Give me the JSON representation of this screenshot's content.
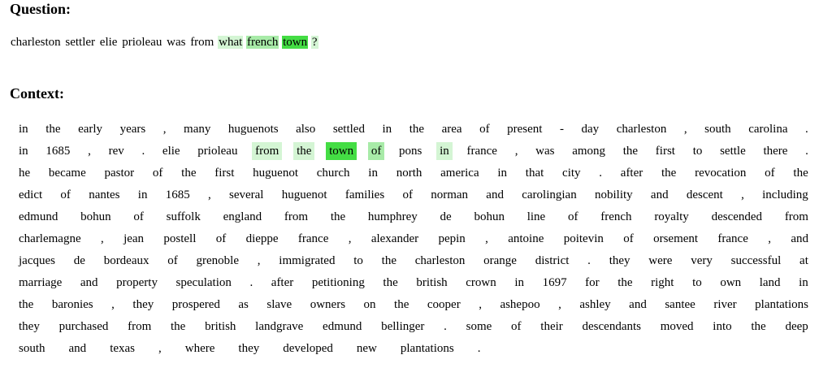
{
  "question_heading": "Question:",
  "context_heading": "Context:",
  "colors": {
    "h1": "#d4f5d4",
    "h2": "#a8eba8",
    "h3": "#44dd44"
  },
  "question_tokens": [
    {
      "t": "charleston",
      "h": 0
    },
    {
      "t": "settler",
      "h": 0
    },
    {
      "t": "elie",
      "h": 0
    },
    {
      "t": "prioleau",
      "h": 0
    },
    {
      "t": "was",
      "h": 0
    },
    {
      "t": "from",
      "h": 0
    },
    {
      "t": "what",
      "h": 1
    },
    {
      "t": "french",
      "h": 2
    },
    {
      "t": "town",
      "h": 3
    },
    {
      "t": "?",
      "h": 1
    }
  ],
  "context_rows": [
    [
      {
        "t": "in"
      },
      {
        "t": "the"
      },
      {
        "t": "early"
      },
      {
        "t": "years"
      },
      {
        "t": ","
      },
      {
        "t": "many"
      },
      {
        "t": "huguenots"
      },
      {
        "t": "also"
      },
      {
        "t": "settled"
      },
      {
        "t": "in"
      },
      {
        "t": "the"
      },
      {
        "t": "area"
      },
      {
        "t": "of"
      },
      {
        "t": "present"
      },
      {
        "t": "-"
      },
      {
        "t": "day"
      },
      {
        "t": "charleston"
      },
      {
        "t": ","
      },
      {
        "t": "south"
      },
      {
        "t": "carolina"
      },
      {
        "t": "."
      }
    ],
    [
      {
        "t": "in"
      },
      {
        "t": "1685"
      },
      {
        "t": ","
      },
      {
        "t": "rev"
      },
      {
        "t": "."
      },
      {
        "t": "elie"
      },
      {
        "t": "prioleau"
      },
      {
        "t": "from",
        "h": 1
      },
      {
        "t": "the",
        "h": 1
      },
      {
        "t": "town",
        "h": 3
      },
      {
        "t": "of",
        "h": 2
      },
      {
        "t": "pons"
      },
      {
        "t": "in",
        "h": 1
      },
      {
        "t": "france"
      },
      {
        "t": ","
      },
      {
        "t": "was"
      },
      {
        "t": "among"
      },
      {
        "t": "the"
      },
      {
        "t": "first"
      },
      {
        "t": "to"
      },
      {
        "t": "settle"
      },
      {
        "t": "there"
      },
      {
        "t": "."
      }
    ],
    [
      {
        "t": "he"
      },
      {
        "t": "became"
      },
      {
        "t": "pastor"
      },
      {
        "t": "of"
      },
      {
        "t": "the"
      },
      {
        "t": "first"
      },
      {
        "t": "huguenot"
      },
      {
        "t": "church"
      },
      {
        "t": "in"
      },
      {
        "t": "north"
      },
      {
        "t": "america"
      },
      {
        "t": "in"
      },
      {
        "t": "that"
      },
      {
        "t": "city"
      },
      {
        "t": "."
      },
      {
        "t": "after"
      },
      {
        "t": "the"
      },
      {
        "t": "revocation"
      },
      {
        "t": "of"
      },
      {
        "t": "the"
      }
    ],
    [
      {
        "t": "edict"
      },
      {
        "t": "of"
      },
      {
        "t": "nantes"
      },
      {
        "t": "in"
      },
      {
        "t": "1685"
      },
      {
        "t": ","
      },
      {
        "t": "several"
      },
      {
        "t": "huguenot"
      },
      {
        "t": "families"
      },
      {
        "t": "of"
      },
      {
        "t": "norman"
      },
      {
        "t": "and"
      },
      {
        "t": "carolingian"
      },
      {
        "t": "nobility"
      },
      {
        "t": "and"
      },
      {
        "t": "descent"
      },
      {
        "t": ","
      },
      {
        "t": "including"
      }
    ],
    [
      {
        "t": "edmund"
      },
      {
        "t": "bohun"
      },
      {
        "t": "of"
      },
      {
        "t": "suffolk"
      },
      {
        "t": "england"
      },
      {
        "t": "from"
      },
      {
        "t": "the"
      },
      {
        "t": "humphrey"
      },
      {
        "t": "de"
      },
      {
        "t": "bohun"
      },
      {
        "t": "line"
      },
      {
        "t": "of"
      },
      {
        "t": "french"
      },
      {
        "t": "royalty"
      },
      {
        "t": "descended"
      },
      {
        "t": "from"
      }
    ],
    [
      {
        "t": "charlemagne"
      },
      {
        "t": ","
      },
      {
        "t": "jean"
      },
      {
        "t": "postell"
      },
      {
        "t": "of"
      },
      {
        "t": "dieppe"
      },
      {
        "t": "france"
      },
      {
        "t": ","
      },
      {
        "t": "alexander"
      },
      {
        "t": "pepin"
      },
      {
        "t": ","
      },
      {
        "t": "antoine"
      },
      {
        "t": "poitevin"
      },
      {
        "t": "of"
      },
      {
        "t": "orsement"
      },
      {
        "t": "france"
      },
      {
        "t": ","
      },
      {
        "t": "and"
      }
    ],
    [
      {
        "t": "jacques"
      },
      {
        "t": "de"
      },
      {
        "t": "bordeaux"
      },
      {
        "t": "of"
      },
      {
        "t": "grenoble"
      },
      {
        "t": ","
      },
      {
        "t": "immigrated"
      },
      {
        "t": "to"
      },
      {
        "t": "the"
      },
      {
        "t": "charleston"
      },
      {
        "t": "orange"
      },
      {
        "t": "district"
      },
      {
        "t": "."
      },
      {
        "t": "they"
      },
      {
        "t": "were"
      },
      {
        "t": "very"
      },
      {
        "t": "successful"
      },
      {
        "t": "at"
      }
    ],
    [
      {
        "t": "marriage"
      },
      {
        "t": "and"
      },
      {
        "t": "property"
      },
      {
        "t": "speculation"
      },
      {
        "t": "."
      },
      {
        "t": "after"
      },
      {
        "t": "petitioning"
      },
      {
        "t": "the"
      },
      {
        "t": "british"
      },
      {
        "t": "crown"
      },
      {
        "t": "in"
      },
      {
        "t": "1697"
      },
      {
        "t": "for"
      },
      {
        "t": "the"
      },
      {
        "t": "right"
      },
      {
        "t": "to"
      },
      {
        "t": "own"
      },
      {
        "t": "land"
      },
      {
        "t": "in"
      }
    ],
    [
      {
        "t": "the"
      },
      {
        "t": "baronies"
      },
      {
        "t": ","
      },
      {
        "t": "they"
      },
      {
        "t": "prospered"
      },
      {
        "t": "as"
      },
      {
        "t": "slave"
      },
      {
        "t": "owners"
      },
      {
        "t": "on"
      },
      {
        "t": "the"
      },
      {
        "t": "cooper"
      },
      {
        "t": ","
      },
      {
        "t": "ashepoo"
      },
      {
        "t": ","
      },
      {
        "t": "ashley"
      },
      {
        "t": "and"
      },
      {
        "t": "santee"
      },
      {
        "t": "river"
      },
      {
        "t": "plantations"
      }
    ],
    [
      {
        "t": "they"
      },
      {
        "t": "purchased"
      },
      {
        "t": "from"
      },
      {
        "t": "the"
      },
      {
        "t": "british"
      },
      {
        "t": "landgrave"
      },
      {
        "t": "edmund"
      },
      {
        "t": "bellinger"
      },
      {
        "t": "."
      },
      {
        "t": "some"
      },
      {
        "t": "of"
      },
      {
        "t": "their"
      },
      {
        "t": "descendants"
      },
      {
        "t": "moved"
      },
      {
        "t": "into"
      },
      {
        "t": "the"
      },
      {
        "t": "deep"
      }
    ],
    [
      {
        "t": "south"
      },
      {
        "t": "and"
      },
      {
        "t": "texas"
      },
      {
        "t": ","
      },
      {
        "t": "where"
      },
      {
        "t": "they"
      },
      {
        "t": "developed"
      },
      {
        "t": "new"
      },
      {
        "t": "plantations"
      },
      {
        "t": "."
      }
    ]
  ]
}
